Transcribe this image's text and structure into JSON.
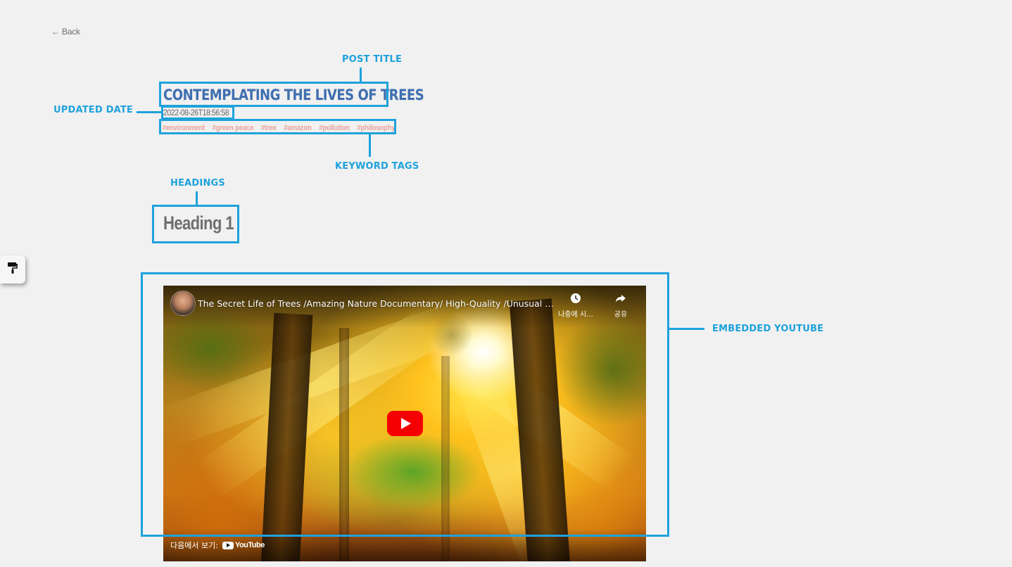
{
  "nav": {
    "back_label": "← Back"
  },
  "post": {
    "title": "Contemplating the Lives of Trees",
    "updated_date": "2022-08-26T18:56:58",
    "tags": [
      "#environment",
      "#green peace",
      "#tree",
      "#amazon",
      "#pollution",
      "#philosophy"
    ],
    "heading_1": "Heading 1"
  },
  "annotations": {
    "post_title": "POST TITLE",
    "updated_date": "UPDATED DATE",
    "keyword_tags": "KEYWORD TAGS",
    "headings": "HEADINGS",
    "embedded_youtube": "EMBEDDED YOUTUBE"
  },
  "tools": {
    "brush_icon": "paint-roller-icon"
  },
  "youtube": {
    "title": "The Secret Life of Trees /Amazing Nature Documentary/ High-Quality /Unusual and Interesting Facts",
    "watch_later_label": "나중에 시...",
    "share_label": "공유",
    "watch_on_label": "다음에서 보기:",
    "logo_text": "YouTube"
  },
  "colors": {
    "annotation": "#1ea2dc",
    "title": "#3f6fb0",
    "tag": "#e8a39b",
    "background": "#f1f1f1",
    "youtube_red": "#f50000"
  }
}
